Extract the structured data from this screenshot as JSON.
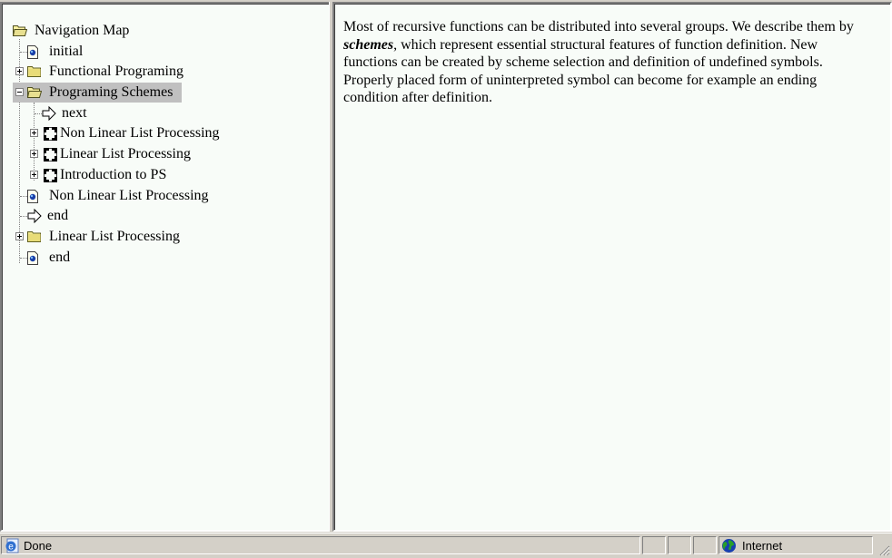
{
  "navigation_tree": {
    "root": {
      "label": "Navigation Map",
      "icon": "folder-open-icon"
    },
    "items": [
      {
        "label": "initial",
        "icon": "document-icon",
        "level": 1,
        "expander": "none"
      },
      {
        "label": "Functional Programing",
        "icon": "folder-closed-icon",
        "level": 1,
        "expander": "plus"
      },
      {
        "label": "Programing Schemes",
        "icon": "folder-open-icon",
        "level": 1,
        "expander": "minus",
        "selected": true
      },
      {
        "label": "next",
        "icon": "arrow-right-icon",
        "level": 2,
        "expander": "none"
      },
      {
        "label": "Non Linear List Processing",
        "icon": "frame-icon",
        "level": 2,
        "expander": "plus"
      },
      {
        "label": "Linear List Processing",
        "icon": "frame-icon",
        "level": 2,
        "expander": "plus"
      },
      {
        "label": "Introduction to PS",
        "icon": "frame-icon",
        "level": 2,
        "expander": "plus"
      },
      {
        "label": "Non Linear List Processing",
        "icon": "document-icon",
        "level": 1,
        "expander": "none"
      },
      {
        "label": "end",
        "icon": "arrow-right-icon",
        "level": 1,
        "expander": "none"
      },
      {
        "label": "Linear List Processing",
        "icon": "folder-closed-icon",
        "level": 1,
        "expander": "plus"
      },
      {
        "label": "end",
        "icon": "document-icon",
        "level": 1,
        "expander": "none"
      }
    ]
  },
  "content": {
    "text_before": "Most of recursive functions can be distributed into several groups. We describe them by ",
    "emphasis": "schemes",
    "text_after": ", which represent essential structural features of function definition. New functions can be created by scheme selection and definition of undefined symbols. Properly placed form of uninterpreted symbol can become for example an ending condition after definition."
  },
  "statusbar": {
    "status_text": "Done",
    "status_icon": "ie-page-icon",
    "zone_text": "Internet",
    "zone_icon": "globe-icon"
  },
  "colors": {
    "frame_background": "#f8fcf8",
    "chrome": "#d4d0c8",
    "selection": "#c0c0c0"
  }
}
